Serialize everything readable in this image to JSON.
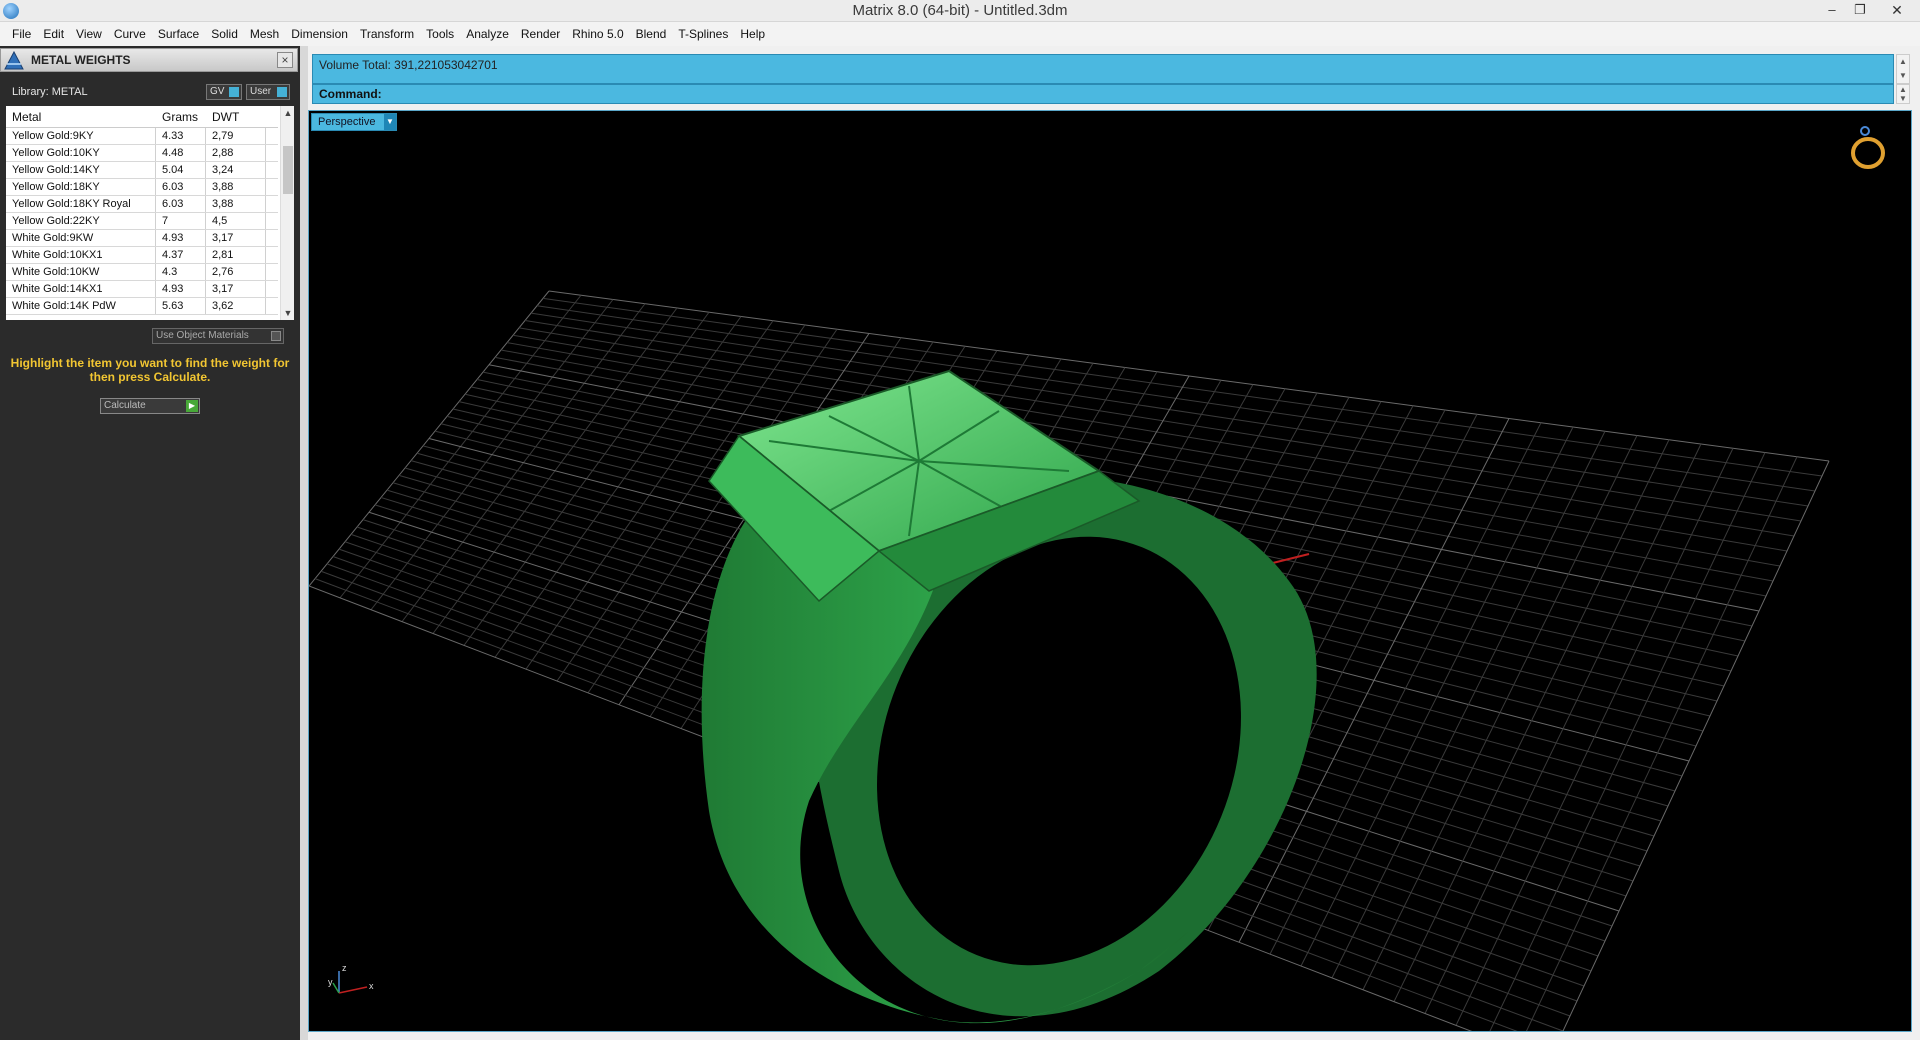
{
  "window": {
    "title": "Matrix 8.0 (64-bit) - Untitled.3dm",
    "minimize": "–",
    "restore": "❐",
    "close": "✕"
  },
  "menu": [
    "File",
    "Edit",
    "View",
    "Curve",
    "Surface",
    "Solid",
    "Mesh",
    "Dimension",
    "Transform",
    "Tools",
    "Analyze",
    "Render",
    "Rhino 5.0",
    "Blend",
    "T-Splines",
    "Help"
  ],
  "panel": {
    "title": "METAL WEIGHTS",
    "close": "×",
    "library": "Library: METAL",
    "gv_label": "GV",
    "user_label": "User",
    "columns": [
      "Metal",
      "Grams",
      "DWT"
    ],
    "rows": [
      [
        "Yellow Gold:9KY",
        "4.33",
        "2,79"
      ],
      [
        "Yellow Gold:10KY",
        "4.48",
        "2,88"
      ],
      [
        "Yellow Gold:14KY",
        "5.04",
        "3,24"
      ],
      [
        "Yellow Gold:18KY",
        "6.03",
        "3,88"
      ],
      [
        "Yellow Gold:18KY Royal",
        "6.03",
        "3,88"
      ],
      [
        "Yellow Gold:22KY",
        "7",
        "4,5"
      ],
      [
        "White Gold:9KW",
        "4.93",
        "3,17"
      ],
      [
        "White Gold:10KX1",
        "4.37",
        "2,81"
      ],
      [
        "White Gold:10KW",
        "4.3",
        "2,76"
      ],
      [
        "White Gold:14KX1",
        "4.93",
        "3,17"
      ],
      [
        "White Gold:14K PdW",
        "5.63",
        "3,62"
      ]
    ],
    "use_object_materials": "Use Object Materials",
    "hint": "Highlight the item you want to find the weight for then press Calculate.",
    "calculate": "Calculate"
  },
  "command": {
    "volume": "Volume Total: 391,221053042701",
    "label": "Command:"
  },
  "viewport": {
    "name": "Perspective",
    "axis_z": "z",
    "axis_y": "y",
    "axis_x": "x",
    "colors": {
      "grid": "#3a3a3a",
      "x_axis": "#c02020",
      "y_axis": "#1f8fb0",
      "ring": "#2a9a44",
      "accent": "#4bb8e0"
    }
  }
}
